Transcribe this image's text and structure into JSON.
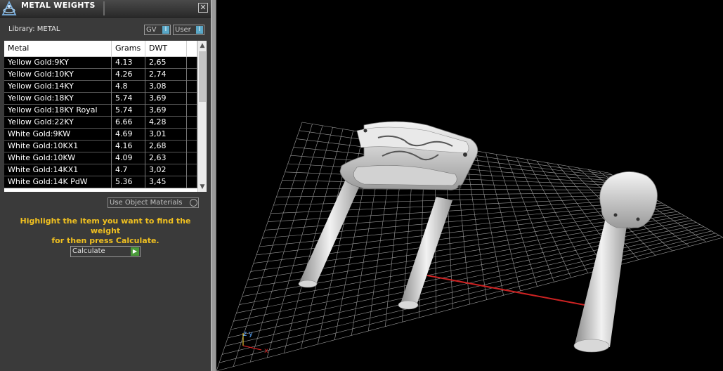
{
  "panel": {
    "title": "METAL WEIGHTS",
    "close_glyph": "✕",
    "library_label": "Library: METAL",
    "toggles": {
      "gv": "GV",
      "user": "User",
      "knob_glyph": "I"
    },
    "table": {
      "headers": [
        "Metal",
        "Grams",
        "DWT"
      ],
      "rows": [
        {
          "metal": "Yellow Gold:9KY",
          "grams": "4.13",
          "dwt": "2,65"
        },
        {
          "metal": "Yellow Gold:10KY",
          "grams": "4.26",
          "dwt": "2,74"
        },
        {
          "metal": "Yellow Gold:14KY",
          "grams": "4.8",
          "dwt": "3,08"
        },
        {
          "metal": "Yellow Gold:18KY",
          "grams": "5.74",
          "dwt": "3,69"
        },
        {
          "metal": "Yellow Gold:18KY Royal",
          "grams": "5.74",
          "dwt": "3,69"
        },
        {
          "metal": "Yellow Gold:22KY",
          "grams": "6.66",
          "dwt": "4,28"
        },
        {
          "metal": "White Gold:9KW",
          "grams": "4.69",
          "dwt": "3,01"
        },
        {
          "metal": "White Gold:10KX1",
          "grams": "4.16",
          "dwt": "2,68"
        },
        {
          "metal": "White Gold:10KW",
          "grams": "4.09",
          "dwt": "2,63"
        },
        {
          "metal": "White Gold:14KX1",
          "grams": "4.7",
          "dwt": "3,02"
        },
        {
          "metal": "White Gold:14K PdW",
          "grams": "5.36",
          "dwt": "3,45"
        }
      ]
    },
    "use_object_materials": "Use Object Materials",
    "instruction_line1": "Highlight the item you want to find the weight",
    "instruction_line2": "for then press Calculate.",
    "calculate_label": "Calculate",
    "colors": {
      "instruction": "#f0c020",
      "panel_bg": "#3a3a3a",
      "accent_blue": "#5aa8c8",
      "go_green": "#4a9a3a"
    }
  },
  "viewport": {
    "axes": {
      "x": "x",
      "y": "y",
      "z": "z"
    },
    "colors": {
      "background": "#000000",
      "grid": "#ffffff",
      "x_axis": "#cc2222",
      "y_axis": "#22aacc"
    }
  }
}
